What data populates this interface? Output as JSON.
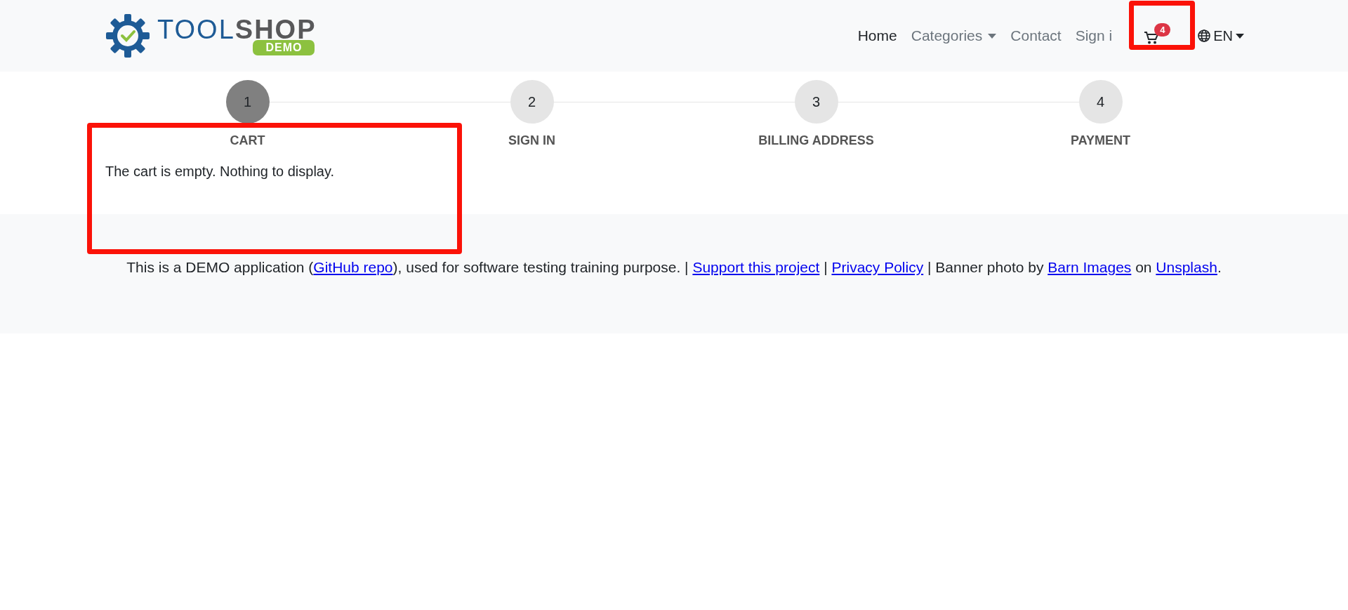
{
  "logo": {
    "word_1": "TOOL",
    "word_2": "SHOP",
    "tag": "DEMO"
  },
  "nav": [
    {
      "kind": "link",
      "label": "Home",
      "selected": true
    },
    {
      "kind": "dropdown",
      "label": "Categories",
      "selected": false
    },
    {
      "kind": "link",
      "label": "Contact",
      "selected": false
    },
    {
      "kind": "link",
      "label": "Sign i",
      "selected": false
    },
    {
      "kind": "cart",
      "badge": "4",
      "highlighted": true
    },
    {
      "kind": "language",
      "label": "EN"
    }
  ],
  "steps": [
    {
      "number": "1",
      "label": "CART",
      "selected": true
    },
    {
      "number": "2",
      "label": "SIGN IN",
      "selected": false
    },
    {
      "number": "3",
      "label": "BILLING ADDRESS",
      "selected": false
    },
    {
      "number": "4",
      "label": "PAYMENT",
      "selected": false
    }
  ],
  "cart": {
    "message": "The cart is empty. Nothing to display.",
    "highlighted": true
  },
  "footer": [
    {
      "kind": "text",
      "text": "This is a DEMO application ("
    },
    {
      "kind": "link",
      "text": "GitHub repo"
    },
    {
      "kind": "text",
      "text": "), used for software testing training purpose. | "
    },
    {
      "kind": "link",
      "text": "Support this project"
    },
    {
      "kind": "text",
      "text": " | "
    },
    {
      "kind": "link",
      "text": "Privacy Policy"
    },
    {
      "kind": "text",
      "text": " | Banner photo by "
    },
    {
      "kind": "link",
      "text": "Barn Images"
    },
    {
      "kind": "text",
      "text": " on "
    },
    {
      "kind": "link",
      "text": "Unsplash"
    },
    {
      "kind": "text",
      "text": "."
    }
  ]
}
